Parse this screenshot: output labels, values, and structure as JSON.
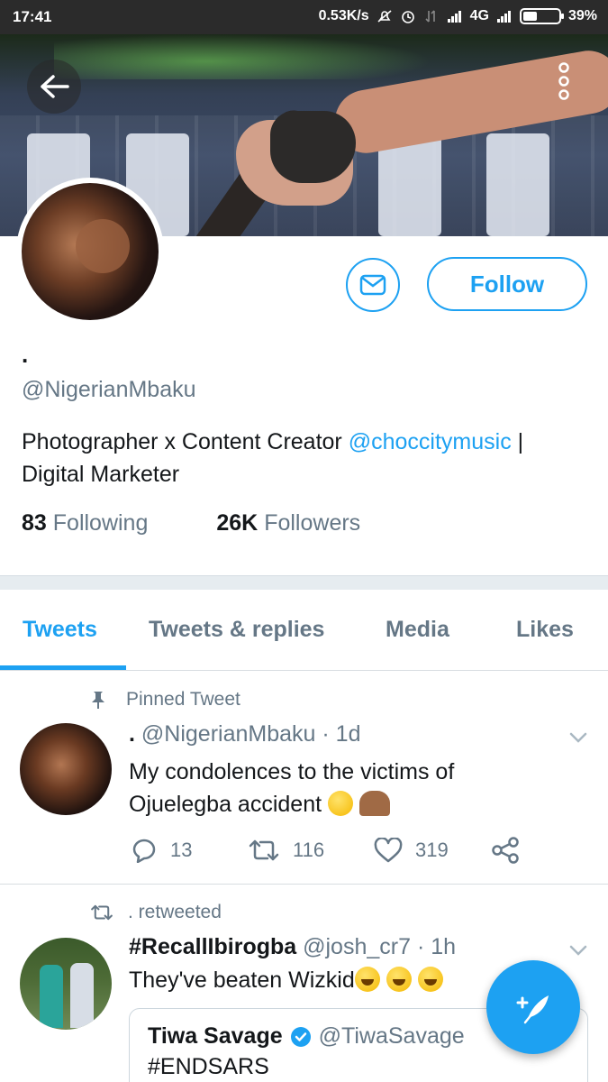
{
  "status_bar": {
    "time": "17:41",
    "speed": "0.53K/s",
    "network": "4G",
    "battery": "39%",
    "battery_level": 0.39
  },
  "profile": {
    "display_name": ".",
    "handle": "@NigerianMbaku",
    "bio_prefix": "Photographer x Content Creator ",
    "bio_mention": "@choccitymusic",
    "bio_suffix": " | Digital Marketer",
    "following_count": "83",
    "following_label": "Following",
    "followers_count": "26K",
    "followers_label": "Followers",
    "follow_button": "Follow"
  },
  "tabs": [
    {
      "label": "Tweets",
      "active": true
    },
    {
      "label": "Tweets & replies",
      "active": false
    },
    {
      "label": "Media",
      "active": false
    },
    {
      "label": "Likes",
      "active": false
    }
  ],
  "tweets": [
    {
      "context": "Pinned Tweet",
      "name": ".",
      "handle": "@NigerianMbaku",
      "time": "1d",
      "text": "My condolences to the victims of Ojuelegba accident",
      "replies": "13",
      "retweets": "116",
      "likes": "319"
    },
    {
      "context": ". retweeted",
      "name": "#RecallIbirogba",
      "handle": "@josh_cr7",
      "time": "1h",
      "text": "They've beaten Wizkid",
      "quote": {
        "name": "Tiwa Savage",
        "handle": "@TiwaSavage",
        "text": "#ENDSARS"
      }
    }
  ],
  "colors": {
    "accent": "#1da1f2",
    "muted": "#657786",
    "text": "#14171a"
  }
}
